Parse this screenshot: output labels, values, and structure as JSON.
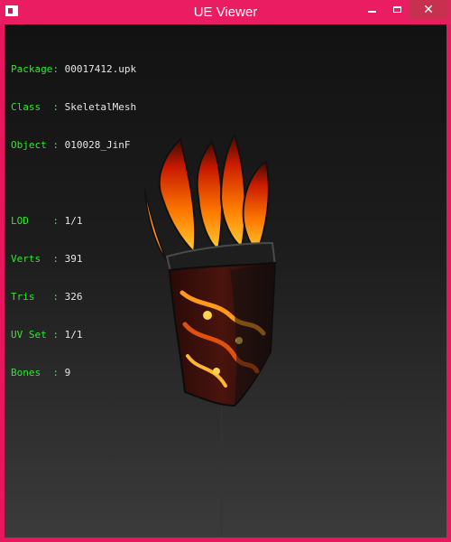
{
  "window": {
    "title": "UE Viewer",
    "icons": {
      "app": "app-window-icon",
      "minimize": "minimize-icon",
      "maximize": "maximize-icon",
      "close": "close-icon"
    },
    "close_glyph": "✕",
    "colors": {
      "frame": "#e8175d",
      "close_button": "#c7304f"
    }
  },
  "info": {
    "package": {
      "key": "Package: ",
      "value": "00017412.upk"
    },
    "class": {
      "key": "Class  : ",
      "value": "SkeletalMesh"
    },
    "object": {
      "key": "Object : ",
      "value": "010028_JinF"
    },
    "lod": {
      "key": "LOD    : ",
      "value": "1/1"
    },
    "verts": {
      "key": "Verts  : ",
      "value": "391"
    },
    "tris": {
      "key": "Tris   : ",
      "value": "326"
    },
    "uvset": {
      "key": "UV Set : ",
      "value": "1/1"
    },
    "bones": {
      "key": "Bones  : ",
      "value": "9"
    }
  },
  "colors": {
    "label": "#2ee82e",
    "value": "#e6e6e6",
    "axis": "#2020d0"
  },
  "viewport": {
    "model_icon": "flame-headdress-model"
  }
}
